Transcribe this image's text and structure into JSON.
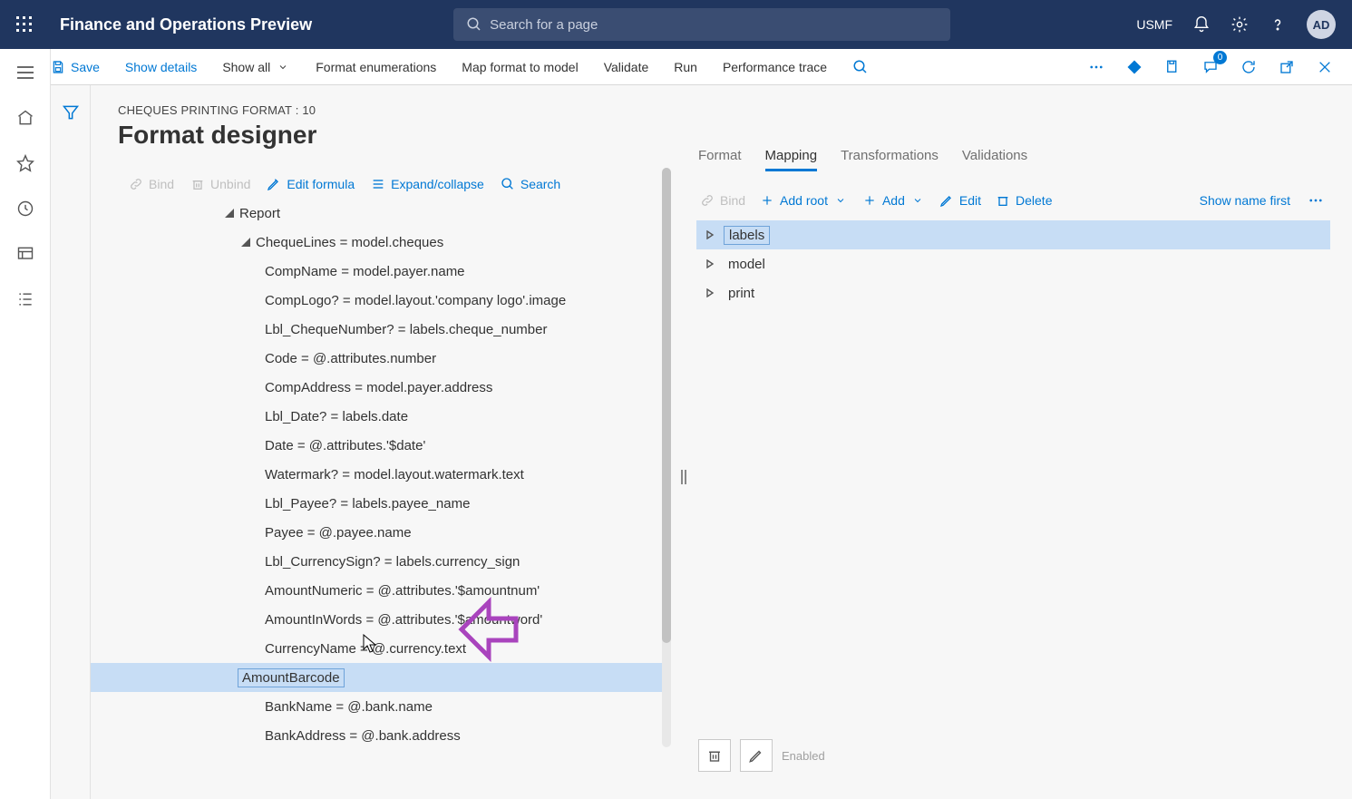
{
  "header": {
    "app_title": "Finance and Operations Preview",
    "search_placeholder": "Search for a page",
    "company": "USMF",
    "avatar_initials": "AD"
  },
  "cmdbar": {
    "save": "Save",
    "show_details": "Show details",
    "show_all": "Show all",
    "format_enum": "Format enumerations",
    "map_model": "Map format to model",
    "validate": "Validate",
    "run": "Run",
    "perf_trace": "Performance trace",
    "badge_count": "0"
  },
  "page": {
    "breadcrumb": "CHEQUES PRINTING FORMAT : 10",
    "title": "Format designer"
  },
  "ltoolbar": {
    "bind": "Bind",
    "unbind": "Unbind",
    "edit_formula": "Edit formula",
    "expand": "Expand/collapse",
    "search": "Search"
  },
  "tree": {
    "root": "Report",
    "chequelines": "ChequeLines = model.cheques",
    "items": [
      "CompName = model.payer.name",
      "CompLogo? = model.layout.'company logo'.image",
      "Lbl_ChequeNumber? = labels.cheque_number",
      "Code = @.attributes.number",
      "CompAddress = model.payer.address",
      "Lbl_Date? = labels.date",
      "Date = @.attributes.'$date'",
      "Watermark? = model.layout.watermark.text",
      "Lbl_Payee? = labels.payee_name",
      "Payee = @.payee.name",
      "Lbl_CurrencySign? = labels.currency_sign",
      "AmountNumeric = @.attributes.'$amountnum'",
      "AmountInWords = @.attributes.'$amountword'",
      "CurrencyName = @.currency.text",
      "AmountBarcode",
      "BankName = @.bank.name",
      "BankAddress = @.bank.address"
    ],
    "selected_index": 14
  },
  "rtabs": {
    "format": "Format",
    "mapping": "Mapping",
    "transformations": "Transformations",
    "validations": "Validations"
  },
  "rtoolbar": {
    "bind": "Bind",
    "add_root": "Add root",
    "add": "Add",
    "edit": "Edit",
    "delete": "Delete",
    "show_name": "Show name first"
  },
  "ds": {
    "items": [
      "labels",
      "model",
      "print"
    ],
    "selected_index": 0
  },
  "rbottom": {
    "enabled": "Enabled"
  }
}
